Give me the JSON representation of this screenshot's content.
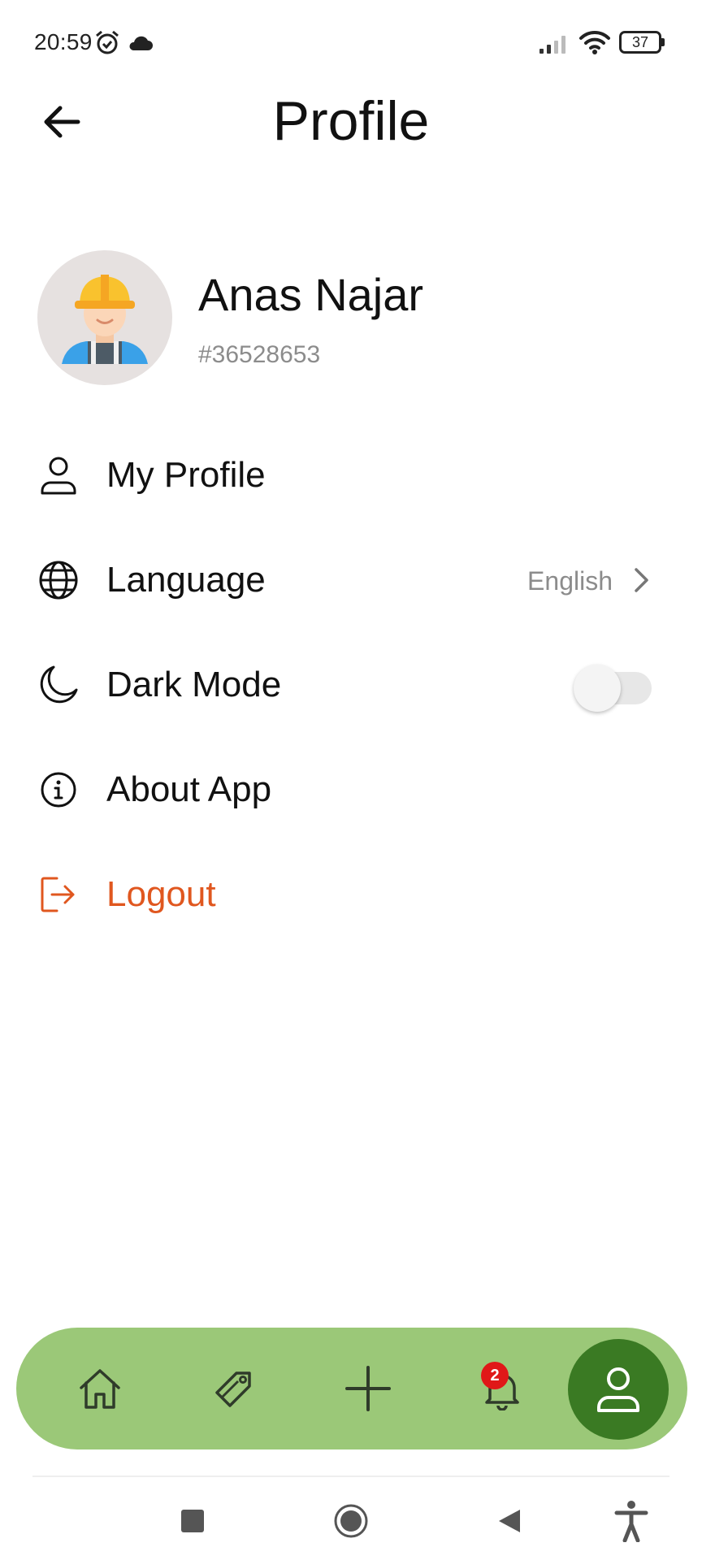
{
  "status_bar": {
    "time": "20:59",
    "battery": "37",
    "icons": [
      "alarm-icon",
      "cloud-icon",
      "signal-icon",
      "wifi-icon",
      "battery-icon"
    ]
  },
  "header": {
    "title": "Profile",
    "back_icon": "arrow-left-icon"
  },
  "profile": {
    "name": "Anas Najar",
    "user_id": "#36528653",
    "avatar_icon": "worker-avatar-icon"
  },
  "menu": {
    "my_profile": "My Profile",
    "language": "Language",
    "language_value": "English",
    "dark_mode": "Dark Mode",
    "dark_mode_on": false,
    "about_app": "About App",
    "logout": "Logout"
  },
  "bottom_nav": {
    "items": [
      "home-icon",
      "tag-icon",
      "plus-icon",
      "bell-icon",
      "user-icon"
    ],
    "active": "user-icon",
    "notification_count": "2"
  },
  "colors": {
    "accent_logout": "#e0571f",
    "nav_background": "#9bc878",
    "nav_active": "#3a7a23",
    "badge": "#e01818"
  }
}
